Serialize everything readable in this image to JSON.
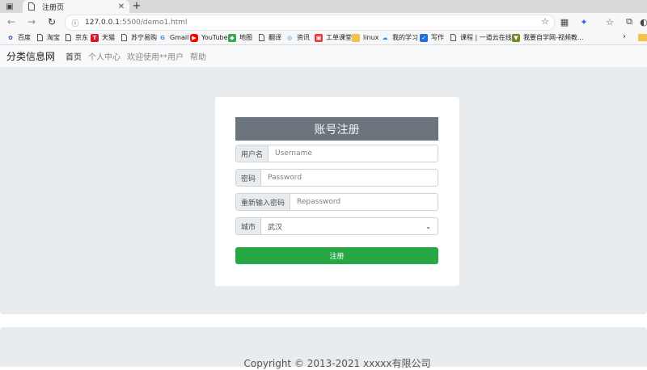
{
  "browser": {
    "tab_title": "注册页",
    "url_host": "127.0.0.1",
    "url_rest": ":5500/demo1.html"
  },
  "bookmarks": [
    "百度",
    "淘宝",
    "京东",
    "天猫",
    "苏宁易购",
    "Gmail",
    "YouTube",
    "地图",
    "翻译",
    "资讯",
    "工单课堂",
    "linux",
    "我的学习",
    "写作",
    "课程 | 一道云在线...",
    "我要自学网-视频教..."
  ],
  "navbar": {
    "brand": "分类信息网",
    "links": [
      "首页",
      "个人中心",
      "欢迎使用**用户",
      "帮助"
    ]
  },
  "form": {
    "title": "账号注册",
    "username_label": "用户名",
    "username_placeholder": "Username",
    "password_label": "密码",
    "password_placeholder": "Password",
    "repassword_label": "重新输入密码",
    "repassword_placeholder": "Repassword",
    "city_label": "城市",
    "city_value": "武汉",
    "submit_label": "注册"
  },
  "footer": {
    "copyright": "Copyright © 2013-2021 xxxxx有限公司"
  },
  "colors": {
    "title_bg": "#6c757d",
    "submit_bg": "#28a745",
    "jumbotron_bg": "#e9ecef"
  }
}
